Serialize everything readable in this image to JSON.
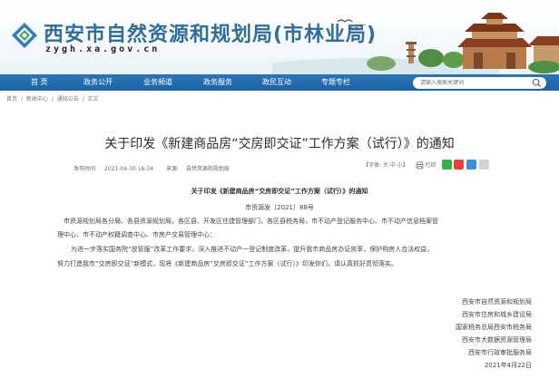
{
  "header": {
    "site_title": "西安市自然资源和规划局(市林业局)",
    "site_domain": "zygh.xa.gov.cn"
  },
  "nav": {
    "items": [
      "首 页",
      "政务公开",
      "业务频道",
      "政务服务",
      "政民互动",
      "专题专栏"
    ],
    "search_placeholder": "请输入搜索关键词"
  },
  "breadcrumb": [
    "首页",
    "/",
    "新闻中心",
    "/",
    "通知公告",
    "/",
    "正文"
  ],
  "article": {
    "title": "关于印发《新建商品房“交房即交证”工作方案（试行）》的通知",
    "publish_label": "发布时间:",
    "publish_time": "2021-04-30 16:34",
    "source_label": "来源:",
    "source": "自然资源和规划局",
    "font_size_label": "【字体: 大 中 小】",
    "print_label": "打印",
    "sub_title": "关于印发《新建商品房“交房即交证”工作方案（试行）》的通知",
    "doc_number": "市资源发〔2021〕88号",
    "paragraphs": [
      "市资源规划局各分局、各县资源规划局，各区县、开发区住建管理部门，各区县税务局，市不动产登记服务中心、市不动产信息档案管",
      "理中心、市不动产权籍调查中心、市房产交易管理中心：",
      "为进一步落实国务院“放管服”改革工作要求，深入推进不动产一登记制度改革，提升我市商品房办证效率，保护购房人合法权益，",
      "努力打造我市“交房即交证”新模式，现将《新建商品房“交房即交证”工作方案（试行）》印发你们，请认真抓好贯彻落实。"
    ],
    "signatures": [
      "西安市自然资源和规划局",
      "西安市住房和城乡建设局",
      "国家税务总局西安市税务局",
      "西安市大数据资源管理局",
      "西安市行政审批服务局",
      "2021年4月22日"
    ]
  },
  "colors": {
    "nav_blue": "#1f67aa",
    "title_blue": "#2f6d9c"
  }
}
